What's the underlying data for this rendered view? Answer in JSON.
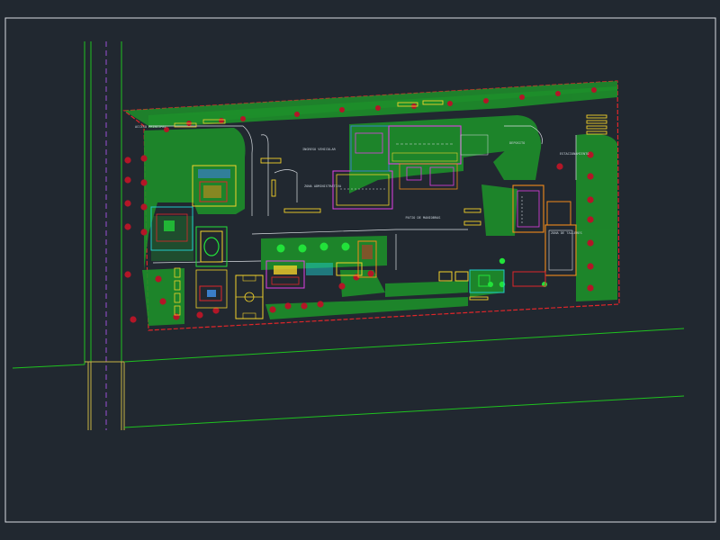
{
  "drawing": {
    "colors": {
      "background": "#212830",
      "frame": "#d9dde2",
      "road_line": "#1fc21f",
      "road_edge": "#c8b445",
      "road_center": "#9a4fd6",
      "boundary": "#e0262a",
      "vegetation": "#1d8f2a",
      "tree": "#b31627",
      "tree_green": "#22e23a",
      "building_yellow": "#f2d22a",
      "building_magenta": "#e13fe6",
      "building_cyan": "#20c9c9",
      "building_orange": "#f28a1a",
      "white_line": "#d9dde2"
    },
    "labels": {
      "access_left": "ACCESO\nPRINCIPAL",
      "ingreso": "INGRESO\nVEHICULAR",
      "zona_admin": "ZONA ADMINISTRATIVA",
      "patio_maniobras": "PATIO DE MANIOBRAS",
      "estacionamiento": "ESTACIONAMIENTO",
      "deposito": "DEPOSITO",
      "zona_talleres": "ZONA DE TALLERES"
    }
  }
}
